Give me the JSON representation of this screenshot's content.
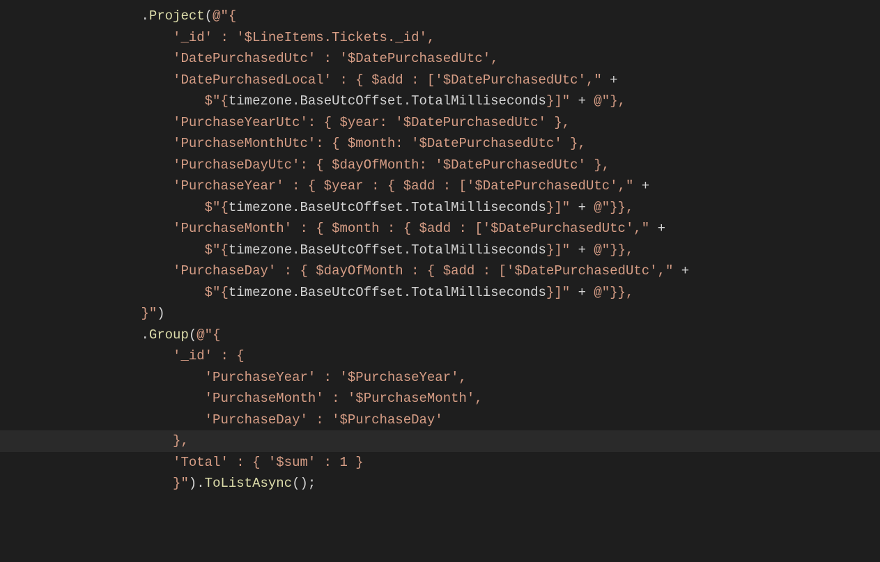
{
  "code": {
    "lines": [
      {
        "indent": "                ",
        "segments": [
          {
            "cls": "pnc",
            "t": "."
          },
          {
            "cls": "mtd",
            "t": "Project"
          },
          {
            "cls": "pnc",
            "t": "("
          },
          {
            "cls": "str",
            "t": "@\"{"
          }
        ]
      },
      {
        "indent": "                    ",
        "segments": [
          {
            "cls": "str",
            "t": "'_id' : '$LineItems.Tickets._id',"
          }
        ]
      },
      {
        "indent": "                    ",
        "segments": [
          {
            "cls": "str",
            "t": "'DatePurchasedUtc' : '$DatePurchasedUtc',"
          }
        ]
      },
      {
        "indent": "                    ",
        "segments": [
          {
            "cls": "str",
            "t": "'DatePurchasedLocal' : { $add : ['$DatePurchasedUtc',\""
          },
          {
            "cls": "op",
            "t": " + "
          }
        ]
      },
      {
        "indent": "                        ",
        "segments": [
          {
            "cls": "str",
            "t": "$\"{"
          },
          {
            "cls": "pnc",
            "t": "timezone.BaseUtcOffset.TotalMilliseconds"
          },
          {
            "cls": "str",
            "t": "}]\""
          },
          {
            "cls": "op",
            "t": " + "
          },
          {
            "cls": "str",
            "t": "@\"},"
          }
        ]
      },
      {
        "indent": "                    ",
        "segments": [
          {
            "cls": "str",
            "t": "'PurchaseYearUtc': { $year: '$DatePurchasedUtc' },"
          }
        ]
      },
      {
        "indent": "                    ",
        "segments": [
          {
            "cls": "str",
            "t": "'PurchaseMonthUtc': { $month: '$DatePurchasedUtc' },"
          }
        ]
      },
      {
        "indent": "                    ",
        "segments": [
          {
            "cls": "str",
            "t": "'PurchaseDayUtc': { $dayOfMonth: '$DatePurchasedUtc' },"
          }
        ]
      },
      {
        "indent": "                    ",
        "segments": [
          {
            "cls": "str",
            "t": "'PurchaseYear' : { $year : { $add : ['$DatePurchasedUtc',\""
          },
          {
            "cls": "op",
            "t": " + "
          }
        ]
      },
      {
        "indent": "                        ",
        "segments": [
          {
            "cls": "str",
            "t": "$\"{"
          },
          {
            "cls": "pnc",
            "t": "timezone.BaseUtcOffset.TotalMilliseconds"
          },
          {
            "cls": "str",
            "t": "}]\""
          },
          {
            "cls": "op",
            "t": " + "
          },
          {
            "cls": "str",
            "t": "@\"}},"
          }
        ]
      },
      {
        "indent": "                    ",
        "segments": [
          {
            "cls": "str",
            "t": "'PurchaseMonth' : { $month : { $add : ['$DatePurchasedUtc',\""
          },
          {
            "cls": "op",
            "t": " + "
          }
        ]
      },
      {
        "indent": "                        ",
        "segments": [
          {
            "cls": "str",
            "t": "$\"{"
          },
          {
            "cls": "pnc",
            "t": "timezone.BaseUtcOffset.TotalMilliseconds"
          },
          {
            "cls": "str",
            "t": "}]\""
          },
          {
            "cls": "op",
            "t": " + "
          },
          {
            "cls": "str",
            "t": "@\"}},"
          }
        ]
      },
      {
        "indent": "                    ",
        "segments": [
          {
            "cls": "str",
            "t": "'PurchaseDay' : { $dayOfMonth : { $add : ['$DatePurchasedUtc',\""
          },
          {
            "cls": "op",
            "t": " + "
          }
        ]
      },
      {
        "indent": "                        ",
        "segments": [
          {
            "cls": "str",
            "t": "$\"{"
          },
          {
            "cls": "pnc",
            "t": "timezone.BaseUtcOffset.TotalMilliseconds"
          },
          {
            "cls": "str",
            "t": "}]\""
          },
          {
            "cls": "op",
            "t": " + "
          },
          {
            "cls": "str",
            "t": "@\"}},"
          }
        ]
      },
      {
        "indent": "                ",
        "segments": [
          {
            "cls": "str",
            "t": "}\""
          },
          {
            "cls": "pnc",
            "t": ")"
          }
        ]
      },
      {
        "indent": "                ",
        "segments": [
          {
            "cls": "pnc",
            "t": "."
          },
          {
            "cls": "mtd",
            "t": "Group"
          },
          {
            "cls": "pnc",
            "t": "("
          },
          {
            "cls": "str",
            "t": "@\"{"
          }
        ]
      },
      {
        "indent": "                    ",
        "segments": [
          {
            "cls": "str",
            "t": "'_id' : {"
          }
        ]
      },
      {
        "indent": "                        ",
        "segments": [
          {
            "cls": "str",
            "t": "'PurchaseYear' : '$PurchaseYear',"
          }
        ]
      },
      {
        "indent": "                        ",
        "segments": [
          {
            "cls": "str",
            "t": "'PurchaseMonth' : '$PurchaseMonth',"
          }
        ]
      },
      {
        "indent": "                        ",
        "segments": [
          {
            "cls": "str",
            "t": "'PurchaseDay' : '$PurchaseDay'"
          }
        ]
      },
      {
        "indent": "                    ",
        "cursor": true,
        "segments": [
          {
            "cls": "str",
            "t": "},"
          }
        ]
      },
      {
        "indent": "                    ",
        "segments": [
          {
            "cls": "str",
            "t": "'Total' : { '$sum' : 1 }"
          }
        ]
      },
      {
        "indent": "                    ",
        "segments": [
          {
            "cls": "str",
            "t": "}\""
          },
          {
            "cls": "pnc",
            "t": ")."
          },
          {
            "cls": "mtd",
            "t": "ToListAsync"
          },
          {
            "cls": "pnc",
            "t": "();"
          }
        ]
      }
    ]
  }
}
